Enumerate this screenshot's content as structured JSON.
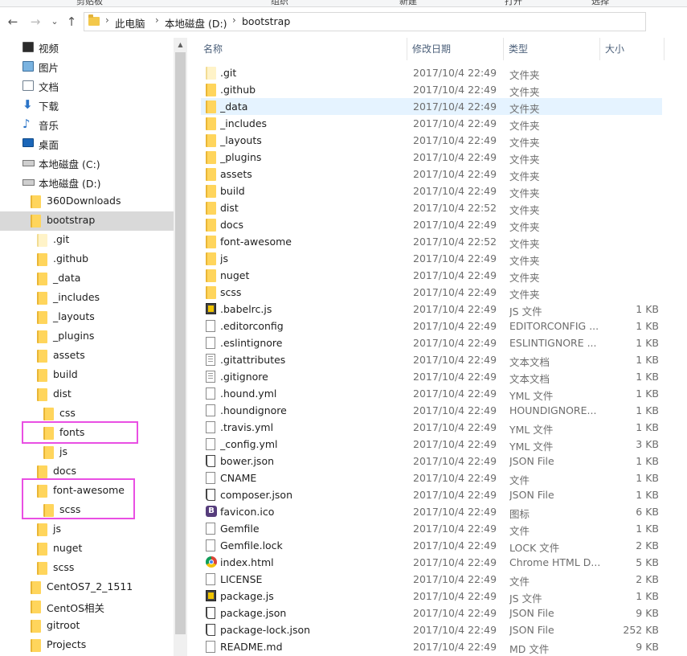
{
  "ribbon": {
    "labels": [
      "剪贴板",
      "组织",
      "新建",
      "打开",
      "选择"
    ]
  },
  "nav": {
    "back": "←",
    "forward": "→",
    "recent": "⌄",
    "up": "↑",
    "separator": "›",
    "breadcrumbs": [
      "此电脑",
      "本地磁盘 (D:)",
      "bootstrap"
    ],
    "caret": "⌄"
  },
  "tree": {
    "items": [
      {
        "label": "视频",
        "icon": "video-icon"
      },
      {
        "label": "图片",
        "icon": "pictures-icon"
      },
      {
        "label": "文档",
        "icon": "documents-icon"
      },
      {
        "label": "下载",
        "icon": "download-icon"
      },
      {
        "label": "音乐",
        "icon": "music-icon"
      },
      {
        "label": "桌面",
        "icon": "desktop-icon"
      },
      {
        "label": "本地磁盘 (C:)",
        "icon": "drive-icon"
      },
      {
        "label": "本地磁盘 (D:)",
        "icon": "drive-icon"
      },
      {
        "label": "360Downloads",
        "icon": "folder-icon"
      },
      {
        "label": "bootstrap",
        "icon": "folder-icon"
      },
      {
        "label": ".git",
        "icon": "folder-icon"
      },
      {
        "label": ".github",
        "icon": "folder-icon"
      },
      {
        "label": "_data",
        "icon": "folder-icon"
      },
      {
        "label": "_includes",
        "icon": "folder-icon"
      },
      {
        "label": "_layouts",
        "icon": "folder-icon"
      },
      {
        "label": "_plugins",
        "icon": "folder-icon"
      },
      {
        "label": "assets",
        "icon": "folder-icon"
      },
      {
        "label": "build",
        "icon": "folder-icon"
      },
      {
        "label": "dist",
        "icon": "folder-icon"
      },
      {
        "label": "css",
        "icon": "folder-icon"
      },
      {
        "label": "fonts",
        "icon": "folder-icon"
      },
      {
        "label": "js",
        "icon": "folder-icon"
      },
      {
        "label": "docs",
        "icon": "folder-icon"
      },
      {
        "label": "font-awesome",
        "icon": "folder-icon"
      },
      {
        "label": "scss",
        "icon": "folder-icon"
      },
      {
        "label": "js",
        "icon": "folder-icon"
      },
      {
        "label": "nuget",
        "icon": "folder-icon"
      },
      {
        "label": "scss",
        "icon": "folder-icon"
      },
      {
        "label": "CentOS7_2_1511",
        "icon": "folder-icon"
      },
      {
        "label": "CentOS相关",
        "icon": "folder-icon"
      },
      {
        "label": "gitroot",
        "icon": "folder-icon"
      },
      {
        "label": "Projects",
        "icon": "folder-icon"
      }
    ],
    "scroll_up": "▲"
  },
  "list": {
    "sort_caret": "^",
    "headers": {
      "name": "名称",
      "date": "修改日期",
      "type": "类型",
      "size": "大小"
    },
    "rows": [
      {
        "name": ".git",
        "date": "2017/10/4 22:49",
        "type": "文件夹",
        "size": "",
        "icon": "folder-icon"
      },
      {
        "name": ".github",
        "date": "2017/10/4 22:49",
        "type": "文件夹",
        "size": "",
        "icon": "folder-icon"
      },
      {
        "name": "_data",
        "date": "2017/10/4 22:49",
        "type": "文件夹",
        "size": "",
        "icon": "folder-icon"
      },
      {
        "name": "_includes",
        "date": "2017/10/4 22:49",
        "type": "文件夹",
        "size": "",
        "icon": "folder-icon"
      },
      {
        "name": "_layouts",
        "date": "2017/10/4 22:49",
        "type": "文件夹",
        "size": "",
        "icon": "folder-icon"
      },
      {
        "name": "_plugins",
        "date": "2017/10/4 22:49",
        "type": "文件夹",
        "size": "",
        "icon": "folder-icon"
      },
      {
        "name": "assets",
        "date": "2017/10/4 22:49",
        "type": "文件夹",
        "size": "",
        "icon": "folder-icon"
      },
      {
        "name": "build",
        "date": "2017/10/4 22:49",
        "type": "文件夹",
        "size": "",
        "icon": "folder-icon"
      },
      {
        "name": "dist",
        "date": "2017/10/4 22:52",
        "type": "文件夹",
        "size": "",
        "icon": "folder-icon"
      },
      {
        "name": "docs",
        "date": "2017/10/4 22:49",
        "type": "文件夹",
        "size": "",
        "icon": "folder-icon"
      },
      {
        "name": "font-awesome",
        "date": "2017/10/4 22:52",
        "type": "文件夹",
        "size": "",
        "icon": "folder-icon"
      },
      {
        "name": "js",
        "date": "2017/10/4 22:49",
        "type": "文件夹",
        "size": "",
        "icon": "folder-icon"
      },
      {
        "name": "nuget",
        "date": "2017/10/4 22:49",
        "type": "文件夹",
        "size": "",
        "icon": "folder-icon"
      },
      {
        "name": "scss",
        "date": "2017/10/4 22:49",
        "type": "文件夹",
        "size": "",
        "icon": "folder-icon"
      },
      {
        "name": ".babelrc.js",
        "date": "2017/10/4 22:49",
        "type": "JS 文件",
        "size": "1 KB",
        "icon": "js-file-icon"
      },
      {
        "name": ".editorconfig",
        "date": "2017/10/4 22:49",
        "type": "EDITORCONFIG ...",
        "size": "1 KB",
        "icon": "file-icon"
      },
      {
        "name": ".eslintignore",
        "date": "2017/10/4 22:49",
        "type": "ESLINTIGNORE ...",
        "size": "1 KB",
        "icon": "file-icon"
      },
      {
        "name": ".gitattributes",
        "date": "2017/10/4 22:49",
        "type": "文本文档",
        "size": "1 KB",
        "icon": "text-file-icon"
      },
      {
        "name": ".gitignore",
        "date": "2017/10/4 22:49",
        "type": "文本文档",
        "size": "1 KB",
        "icon": "text-file-icon"
      },
      {
        "name": ".hound.yml",
        "date": "2017/10/4 22:49",
        "type": "YML 文件",
        "size": "1 KB",
        "icon": "file-icon"
      },
      {
        "name": ".houndignore",
        "date": "2017/10/4 22:49",
        "type": "HOUNDIGNORE...",
        "size": "1 KB",
        "icon": "file-icon"
      },
      {
        "name": ".travis.yml",
        "date": "2017/10/4 22:49",
        "type": "YML 文件",
        "size": "1 KB",
        "icon": "file-icon"
      },
      {
        "name": "_config.yml",
        "date": "2017/10/4 22:49",
        "type": "YML 文件",
        "size": "3 KB",
        "icon": "file-icon"
      },
      {
        "name": "bower.json",
        "date": "2017/10/4 22:49",
        "type": "JSON File",
        "size": "1 KB",
        "icon": "json-file-icon"
      },
      {
        "name": "CNAME",
        "date": "2017/10/4 22:49",
        "type": "文件",
        "size": "1 KB",
        "icon": "file-icon"
      },
      {
        "name": "composer.json",
        "date": "2017/10/4 22:49",
        "type": "JSON File",
        "size": "1 KB",
        "icon": "json-file-icon"
      },
      {
        "name": "favicon.ico",
        "date": "2017/10/4 22:49",
        "type": "图标",
        "size": "6 KB",
        "icon": "bootstrap-icon"
      },
      {
        "name": "Gemfile",
        "date": "2017/10/4 22:49",
        "type": "文件",
        "size": "1 KB",
        "icon": "file-icon"
      },
      {
        "name": "Gemfile.lock",
        "date": "2017/10/4 22:49",
        "type": "LOCK 文件",
        "size": "2 KB",
        "icon": "file-icon"
      },
      {
        "name": "index.html",
        "date": "2017/10/4 22:49",
        "type": "Chrome HTML D...",
        "size": "5 KB",
        "icon": "chrome-icon"
      },
      {
        "name": "LICENSE",
        "date": "2017/10/4 22:49",
        "type": "文件",
        "size": "2 KB",
        "icon": "file-icon"
      },
      {
        "name": "package.js",
        "date": "2017/10/4 22:49",
        "type": "JS 文件",
        "size": "1 KB",
        "icon": "js-file-icon"
      },
      {
        "name": "package.json",
        "date": "2017/10/4 22:49",
        "type": "JSON File",
        "size": "9 KB",
        "icon": "json-file-icon"
      },
      {
        "name": "package-lock.json",
        "date": "2017/10/4 22:49",
        "type": "JSON File",
        "size": "252 KB",
        "icon": "json-file-icon"
      },
      {
        "name": "README.md",
        "date": "2017/10/4 22:49",
        "type": "MD 文件",
        "size": "9 KB",
        "icon": "file-icon"
      }
    ]
  },
  "colors": {
    "highlight_box": "#e94fe3",
    "selected_tree": "#d9d9d9",
    "hover_row": "#e5f3ff",
    "folder": "#ffd55c"
  }
}
